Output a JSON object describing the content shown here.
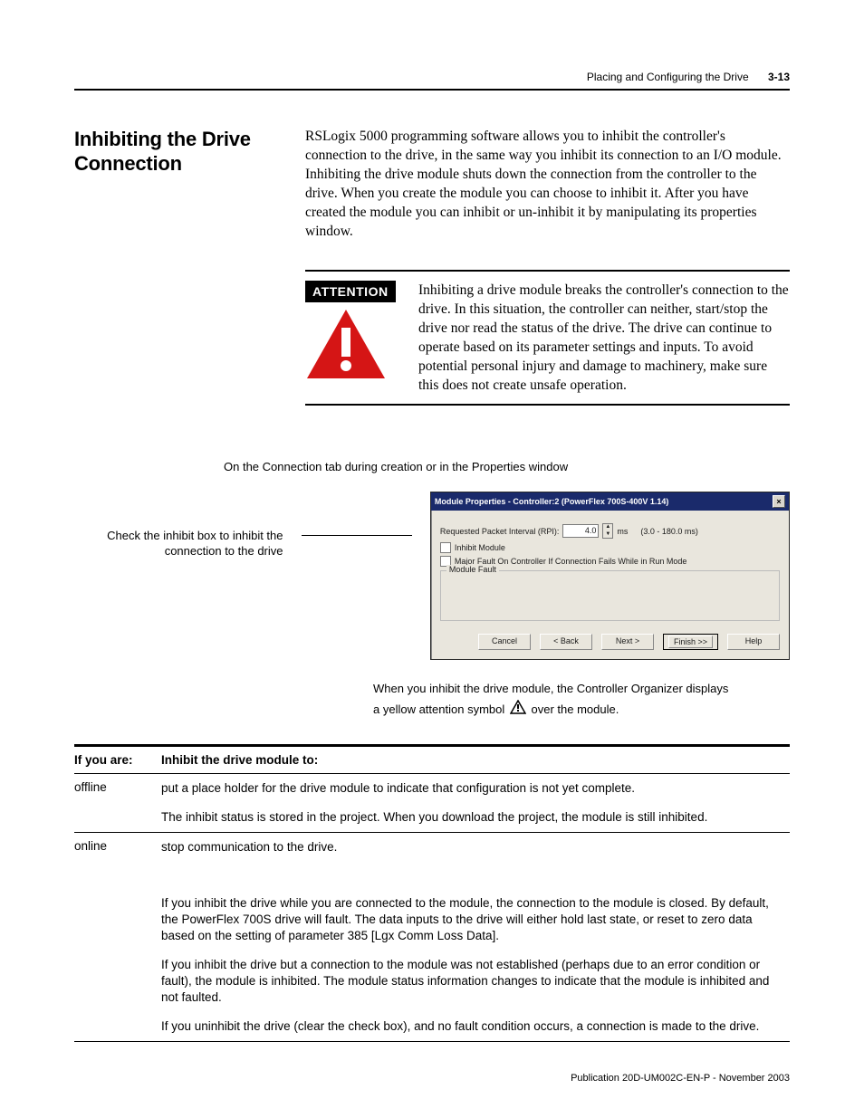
{
  "running_head": {
    "title": "Placing and Configuring the Drive",
    "page": "3-13"
  },
  "section_heading": "Inhibiting the Drive Connection",
  "intro_para": "RSLogix 5000 programming software allows you to inhibit the controller's connection to the drive, in the same way you inhibit its connection to an I/O module. Inhibiting the drive module shuts down the connection from the controller to the drive. When you create the module you can choose to inhibit it. After you have created the module you can inhibit or un-inhibit it by manipulating its properties window.",
  "attention": {
    "label": "ATTENTION",
    "text": "Inhibiting a drive module breaks the controller's connection to the drive. In this situation, the controller can neither, start/stop the drive nor read the status of the drive. The drive can continue to operate based on its parameter settings and inputs. To avoid potential personal injury and damage to machinery, make sure this does not create unsafe operation."
  },
  "mid_caption": "On the Connection tab during creation or in the Properties window",
  "callout_text": "Check the inhibit box to inhibit the connection to the drive",
  "dialog": {
    "title": "Module Properties - Controller:2 (PowerFlex 700S-400V 1.14)",
    "rpi_label": "Requested Packet Interval (RPI):",
    "rpi_value": "4.0",
    "rpi_unit": "ms",
    "rpi_range": "(3.0 - 180.0 ms)",
    "inhibit_label": "Inhibit Module",
    "major_fault_label": "Major Fault On Controller If Connection Fails While in Run Mode",
    "fieldset_legend": "Module Fault",
    "buttons": {
      "cancel": "Cancel",
      "back": "< Back",
      "next": "Next >",
      "finish": "Finish >>",
      "help": "Help"
    }
  },
  "post_dialog_line1": "When you inhibit the drive module, the Controller Organizer displays",
  "post_dialog_line2a": "a yellow attention symbol",
  "post_dialog_line2b": "over the module.",
  "table": {
    "head_c1": "If you are:",
    "head_c2": "Inhibit the drive module to:",
    "rows": [
      {
        "c1": "offline",
        "c2": [
          "put a place holder for the drive module to indicate that configuration is not yet complete.",
          "The inhibit status is stored in the project. When you download the project, the module is still inhibited."
        ]
      },
      {
        "c1": "online",
        "c2": [
          "stop communication to the drive.",
          "If you inhibit the drive while you are connected to the module, the connection to the module is closed. By default, the PowerFlex 700S drive will fault. The data inputs to the drive will either hold last state, or reset to zero data based on the setting of parameter 385 [Lgx Comm Loss Data].",
          "If you inhibit the drive but a connection to the module was not established (perhaps due to an error condition or fault), the module is inhibited. The module status information changes to indicate that the module is inhibited and not faulted.",
          "If you uninhibit the drive (clear the check box), and no fault condition occurs, a connection is made to the drive."
        ]
      }
    ]
  },
  "footer": "Publication 20D-UM002C-EN-P - November 2003"
}
